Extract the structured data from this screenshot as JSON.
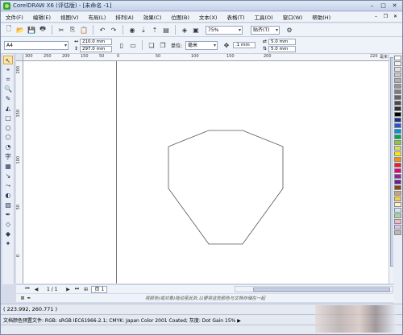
{
  "window": {
    "title": "CorelDRAW X6 (评估版) - [未命名 -1]"
  },
  "menu": [
    "文件(F)",
    "编辑(E)",
    "视图(V)",
    "布局(L)",
    "排列(A)",
    "效果(C)",
    "位图(B)",
    "文本(X)",
    "表格(T)",
    "工具(O)",
    "窗口(W)",
    "帮助(H)"
  ],
  "toolbar": {
    "zoom": "75%",
    "snap": "贴齐(T)"
  },
  "propbar": {
    "paper": "A4",
    "width": "210.0 mm",
    "height": "297.0 mm",
    "units_label": "单位:",
    "units": "毫米",
    "nudge": ".1 mm",
    "dup_x": "5.0 mm",
    "dup_y": "5.0 mm"
  },
  "hruler": [
    "300",
    "250",
    "200",
    "150",
    "100",
    "50",
    "0",
    "50",
    "100",
    "150",
    "200",
    "220",
    "毫米"
  ],
  "vruler": [
    "200",
    "150",
    "100",
    "50",
    "0"
  ],
  "pagenav": {
    "position": "1 / 1",
    "page_tab": "页 1"
  },
  "hint": "将颜色(或对象)拖动至此处,以便将这些颜色与文档存储在一起",
  "status": {
    "coords": "( 223.992, 260.771 )",
    "color_profile": "文档颜色预置文件: RGB: sRGB IEC61966-2.1; CMYK: Japan Color 2001 Coated; 灰度: Dot Gain 15% ▶"
  },
  "palette_colors": [
    "#ffffff",
    "#f2f2f2",
    "#e0e0e0",
    "#c8c8c8",
    "#b0b0b0",
    "#969696",
    "#7d7d7d",
    "#646464",
    "#4b4b4b",
    "#323232",
    "#000000",
    "#1b2f8f",
    "#2456d3",
    "#0091e0",
    "#00a651",
    "#8dc63f",
    "#d4e157",
    "#ffe600",
    "#ff8c00",
    "#ed1c24",
    "#e5007e",
    "#92278f",
    "#6a1b9a",
    "#8b4513",
    "#c8a27a",
    "#f4d03f",
    "#fdf5c9",
    "#cfe8f8",
    "#a8d5a2",
    "#f5b7c5",
    "#d9c2e8",
    "#b8b8b8"
  ]
}
